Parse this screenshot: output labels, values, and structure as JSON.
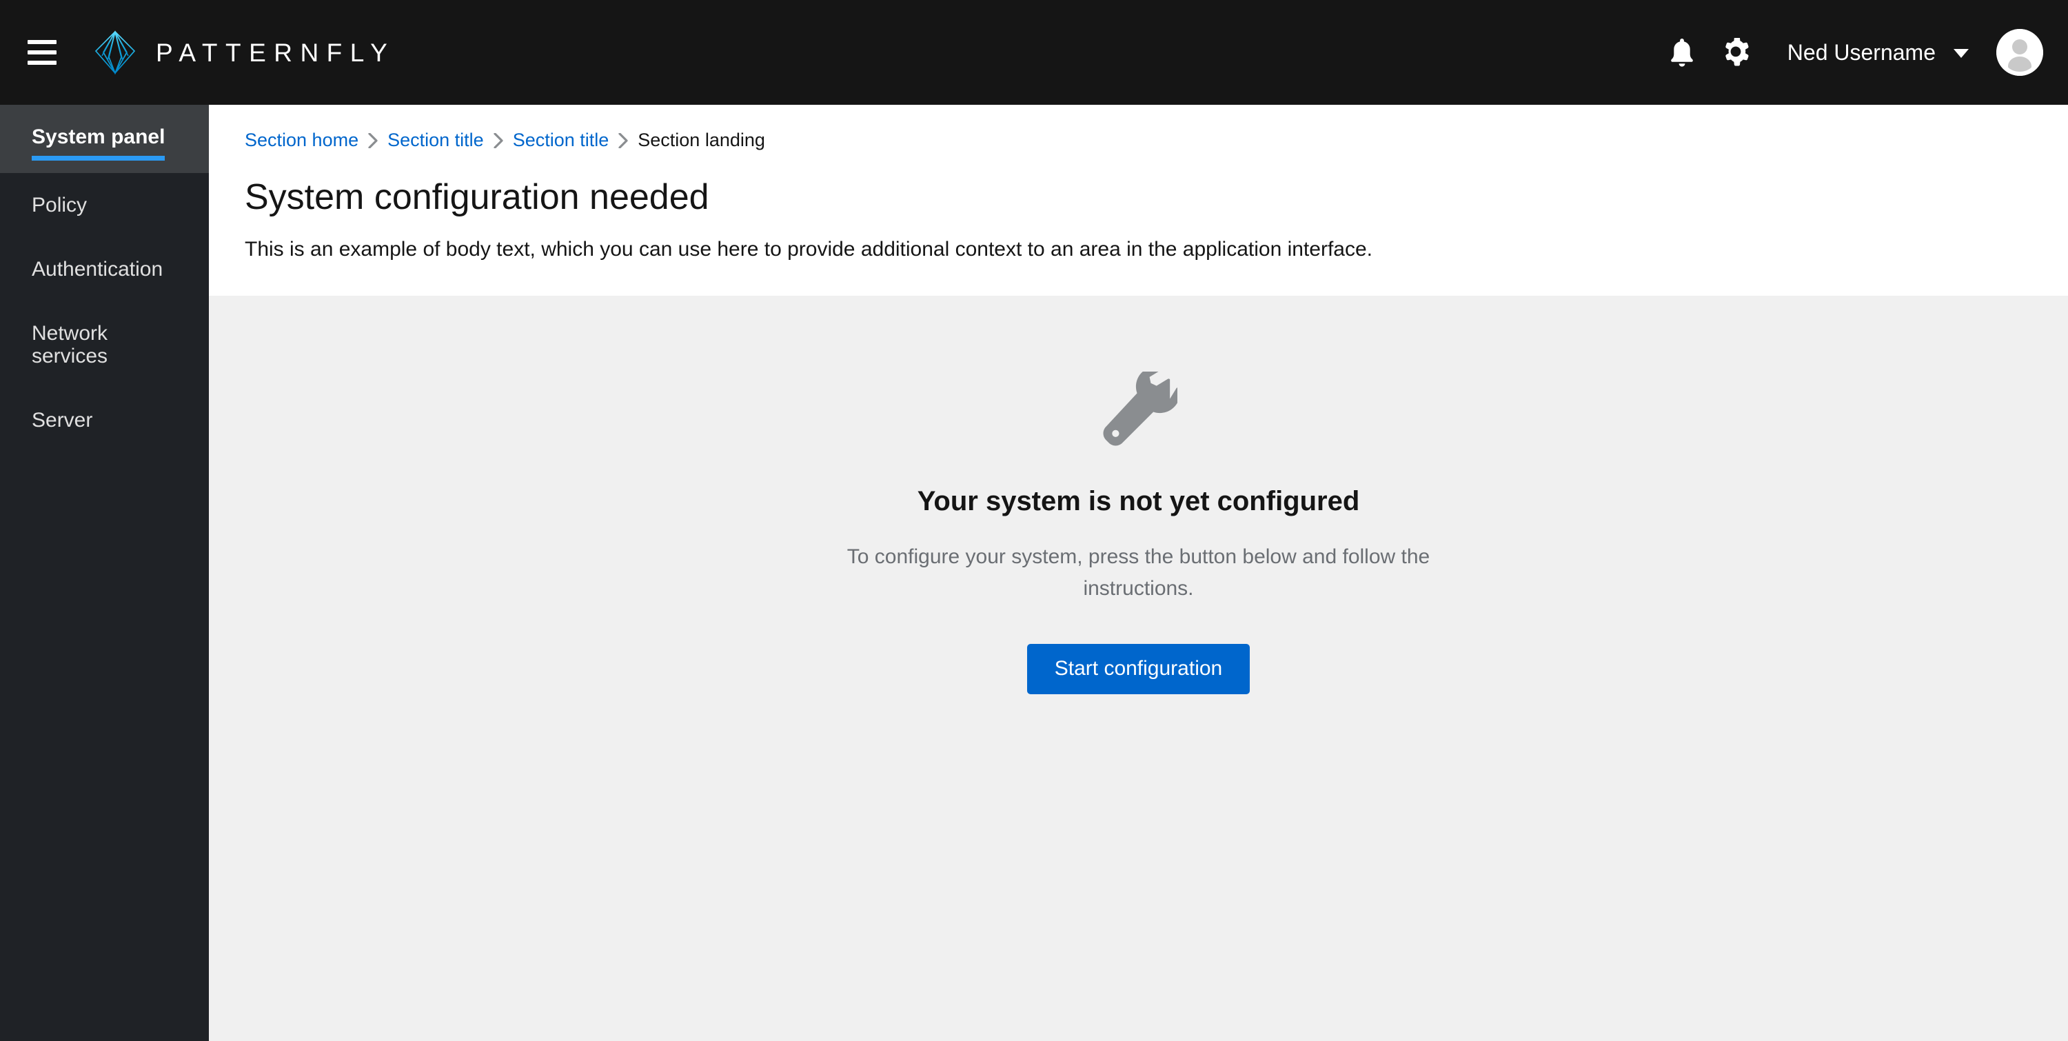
{
  "masthead": {
    "hamburger_label": "Global navigation toggle",
    "brand_name": "PATTERNFLY",
    "notification_icon": "bell-icon",
    "settings_icon": "gear-icon",
    "user_name": "Ned Username",
    "avatar_icon": "user-avatar-icon",
    "colors": {
      "background": "#151515",
      "logo_cyan": "#2bc4f5",
      "logo_blue": "#0099d3"
    }
  },
  "sidebar": {
    "background": "#1f2226",
    "active_background": "#3c3f42",
    "active_accent": "#2b9af3",
    "items": [
      {
        "label": "System panel",
        "active": true
      },
      {
        "label": "Policy",
        "active": false
      },
      {
        "label": "Authentication",
        "active": false
      },
      {
        "label": "Network services",
        "active": false
      },
      {
        "label": "Server",
        "active": false
      }
    ]
  },
  "page": {
    "breadcrumb": [
      {
        "label": "Section home",
        "current": false
      },
      {
        "label": "Section title",
        "current": false
      },
      {
        "label": "Section title",
        "current": false
      },
      {
        "label": "Section landing",
        "current": true
      }
    ],
    "breadcrumb_separator_icon": "chevron-right-icon",
    "title": "System configuration needed",
    "body_text": "This is an example of body text, which you can use here to provide additional context to an area in the application interface.",
    "link_color": "#0066cc"
  },
  "empty_state": {
    "icon": "wrench-icon",
    "icon_color": "#8a8d90",
    "title": "Your system is not yet configured",
    "description": "To configure your system, press the button below and follow the instructions.",
    "primary_button_label": "Start configuration",
    "primary_button_color": "#0066cc",
    "background": "#f0f0f0"
  }
}
